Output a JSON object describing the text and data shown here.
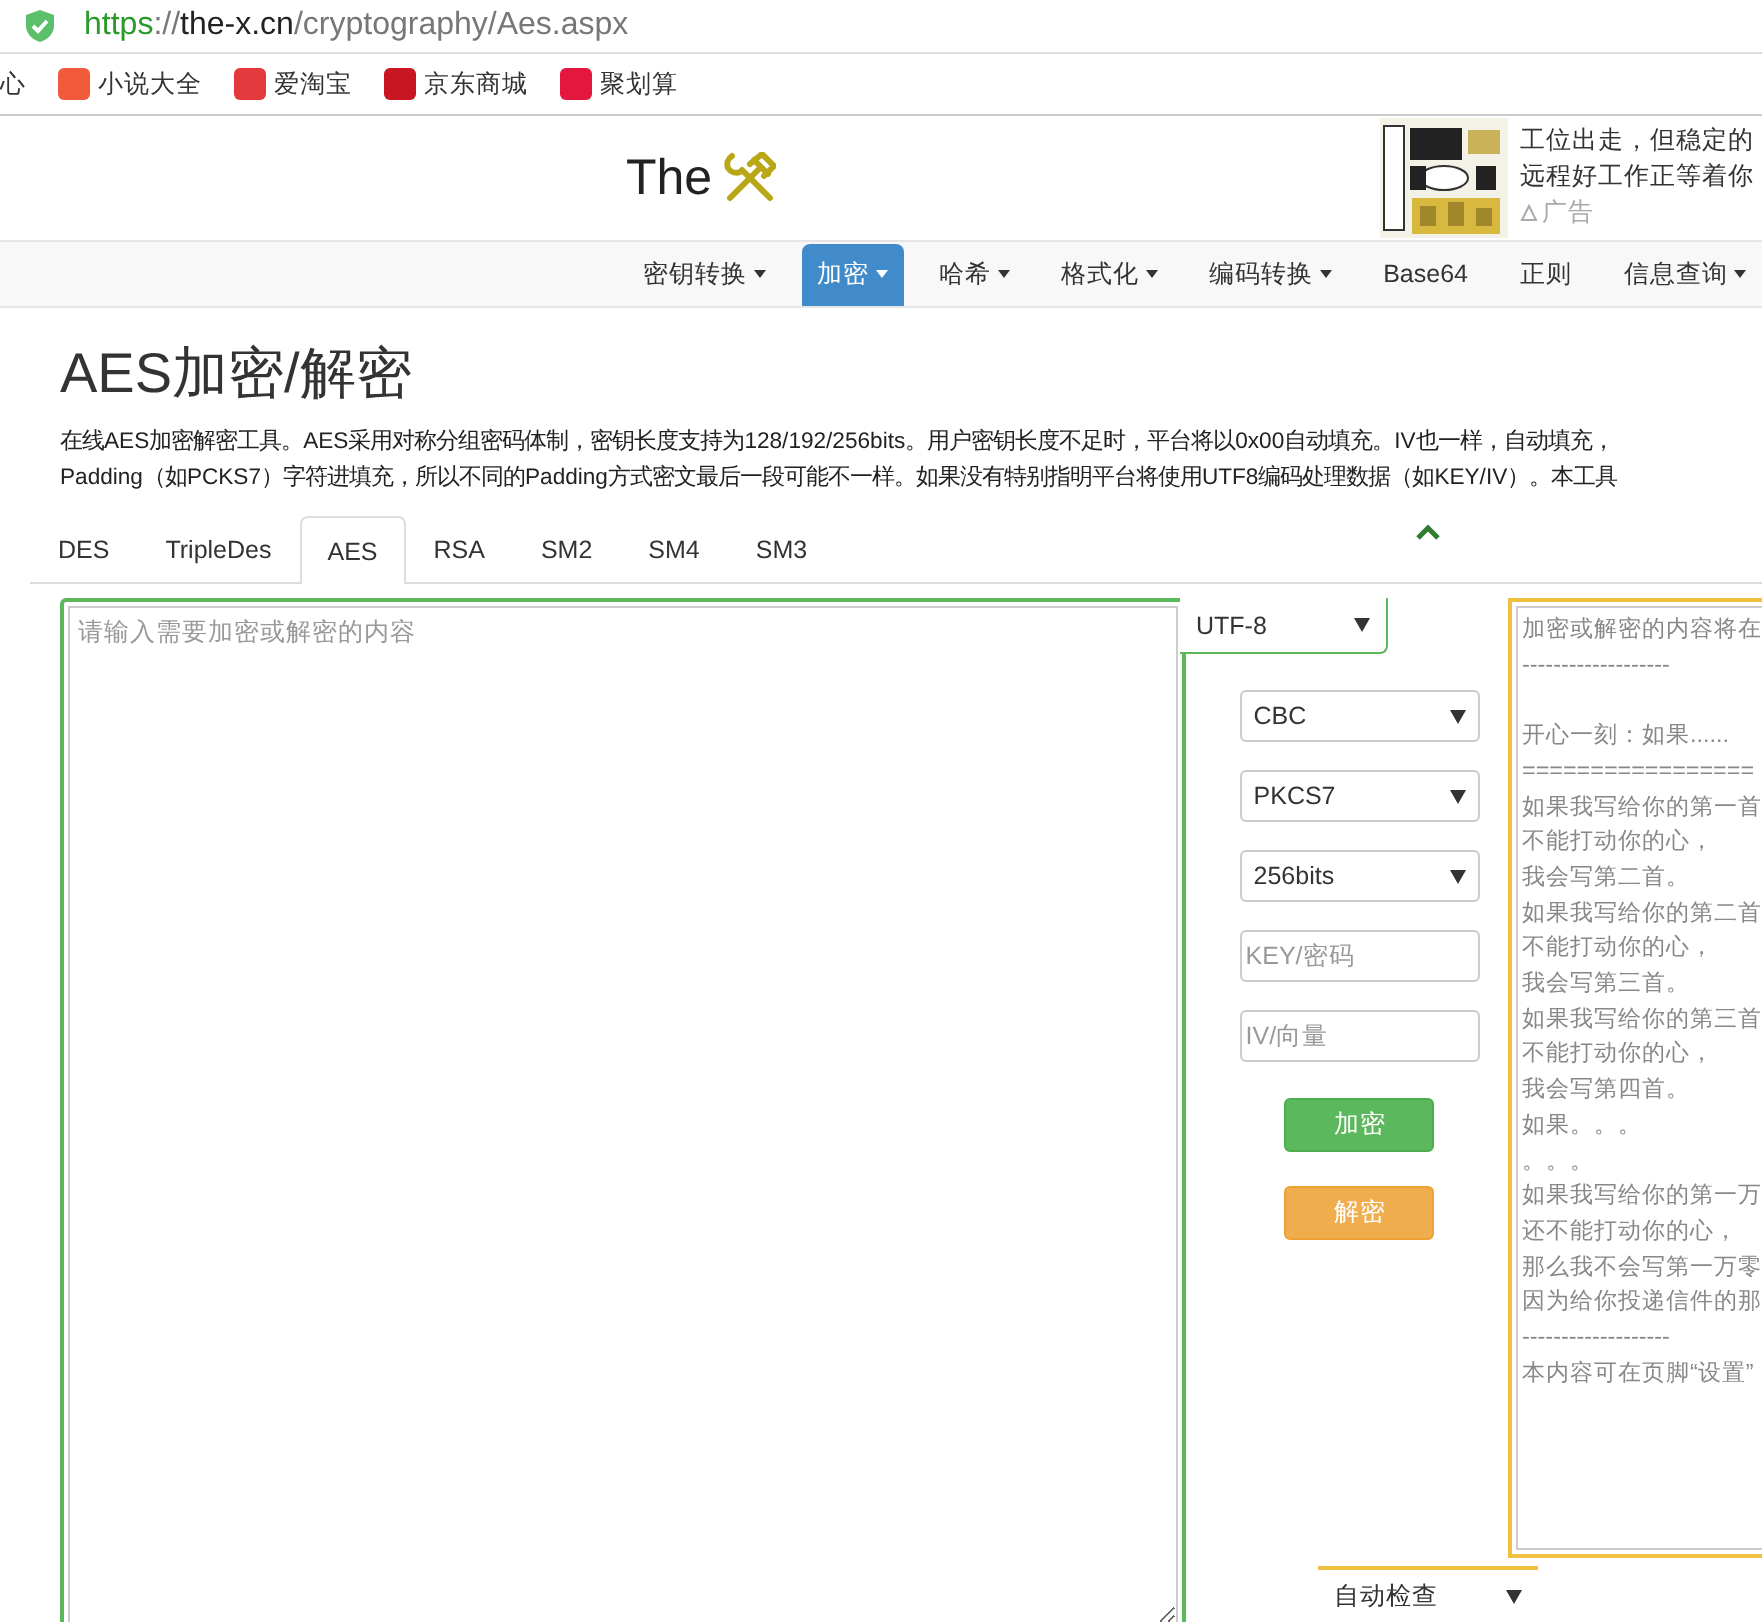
{
  "address_bar": {
    "url_parts": [
      {
        "text": "https",
        "kind": "scheme"
      },
      {
        "text": "://",
        "kind": "path"
      },
      {
        "text": "the-x.cn",
        "kind": "host"
      },
      {
        "text": "/cryptography/Aes.aspx",
        "kind": "path"
      }
    ]
  },
  "bookmarks": [
    {
      "label": "心",
      "kind": "plain"
    },
    {
      "label": "小说大全",
      "kind": "novel"
    },
    {
      "label": "爱淘宝",
      "kind": "taobao"
    },
    {
      "label": "京东商城",
      "kind": "jd"
    },
    {
      "label": "聚划算",
      "kind": "ju"
    }
  ],
  "header": {
    "logo": "The",
    "ad": {
      "lines": [
        "工位出走，但稳定的",
        "远程好工作正等着你"
      ],
      "tag": "广告"
    }
  },
  "nav": [
    {
      "label": "密钥转换",
      "dropdown": true,
      "selected": false
    },
    {
      "label": "加密",
      "dropdown": true,
      "selected": true
    },
    {
      "label": "哈希",
      "dropdown": true,
      "selected": false
    },
    {
      "label": "格式化",
      "dropdown": true,
      "selected": false
    },
    {
      "label": "编码转换",
      "dropdown": true,
      "selected": false
    },
    {
      "label": "Base64",
      "dropdown": false,
      "selected": false
    },
    {
      "label": "正则",
      "dropdown": false,
      "selected": false
    },
    {
      "label": "信息查询",
      "dropdown": true,
      "selected": false
    }
  ],
  "title": "AES加密/解密",
  "description": [
    "在线AES加密解密工具。AES采用对称分组密码体制，密钥长度支持为128/192/256bits。用户密钥长度不足时，平台将以0x00自动填充。IV也一样，自动填充，",
    "Padding（如PCKS7）字符进填充，所以不同的Padding方式密文最后一段可能不一样。如果没有特别指明平台将使用UTF8编码处理数据（如KEY/IV）。本工具"
  ],
  "tabs": [
    {
      "label": "DES",
      "selected": false
    },
    {
      "label": "TripleDes",
      "selected": false
    },
    {
      "label": "AES",
      "selected": true
    },
    {
      "label": "RSA",
      "selected": false
    },
    {
      "label": "SM2",
      "selected": false
    },
    {
      "label": "SM4",
      "selected": false
    },
    {
      "label": "SM3",
      "selected": false
    }
  ],
  "input": {
    "placeholder": "请输入需要加密或解密的内容"
  },
  "encoding": {
    "value": "UTF-8"
  },
  "controls": [
    {
      "kind": "select",
      "value": "CBC"
    },
    {
      "kind": "select",
      "value": "PKCS7"
    },
    {
      "kind": "select",
      "value": "256bits"
    },
    {
      "kind": "input",
      "placeholder": "KEY/密码"
    },
    {
      "kind": "input",
      "placeholder": "IV/向量"
    }
  ],
  "buttons": [
    {
      "label": "加密",
      "kind": "encrypt"
    },
    {
      "label": "解密",
      "kind": "decrypt"
    }
  ],
  "output": {
    "blocks": [
      [
        "加密或解密的内容将在",
        "-------------------"
      ],
      [
        "开心一刻：如果......",
        "=================",
        "如果我写给你的第一首",
        "不能打动你的心，",
        "我会写第二首。",
        "如果我写给你的第二首",
        "不能打动你的心，",
        "我会写第三首。",
        "如果我写给你的第三首",
        "不能打动你的心，",
        "我会写第四首。",
        "如果。。。",
        "。。。",
        "如果我写给你的第一万",
        "还不能打动你的心，",
        "那么我不会写第一万零",
        "因为给你投递信件的那",
        "-------------------",
        "本内容可在页脚“设置”"
      ]
    ]
  },
  "detect": {
    "value": "自动检查"
  }
}
